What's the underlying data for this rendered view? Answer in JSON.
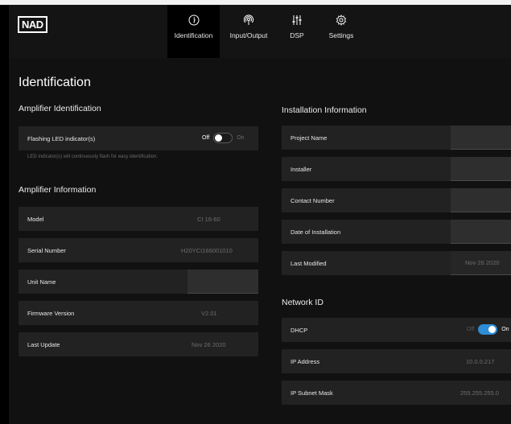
{
  "header": {
    "logo": "NAD",
    "tabs": [
      {
        "label": "Identification",
        "icon": "info-icon",
        "active": true
      },
      {
        "label": "Input/Output",
        "icon": "broadcast-icon",
        "active": false
      },
      {
        "label": "DSP",
        "icon": "sliders-icon",
        "active": false
      },
      {
        "label": "Settings",
        "icon": "gear-icon",
        "active": false
      }
    ]
  },
  "page": {
    "title": "Identification"
  },
  "amp_id": {
    "title": "Amplifier Identification",
    "flash_label": "Flashing LED indicator(s)",
    "off_label": "Off",
    "on_label": "On",
    "note": "LED indicator(s) will continuously flash for easy identification."
  },
  "amp_info": {
    "title": "Amplifier Information",
    "rows": [
      {
        "label": "Model",
        "value": "CI 16-60"
      },
      {
        "label": "Serial Number",
        "value": "H20YCI166001010"
      },
      {
        "label": "Unit Name",
        "value": ""
      },
      {
        "label": "Firmware Version",
        "value": "V2.01"
      },
      {
        "label": "Last Update",
        "value": "Nov 26 2020"
      }
    ]
  },
  "install": {
    "title": "Installation Information",
    "rows": [
      {
        "label": "Project Name",
        "value": ""
      },
      {
        "label": "Installer",
        "value": ""
      },
      {
        "label": "Contact Number",
        "value": ""
      },
      {
        "label": "Date of Installation",
        "value": ""
      },
      {
        "label": "Last Modified",
        "value": "Nov 26 2020"
      }
    ]
  },
  "network": {
    "title": "Network ID",
    "dhcp_label": "DHCP",
    "off_label": "Off",
    "on_label": "On",
    "ip_label": "IP Address",
    "ip_value": "10.0.0.217",
    "mask_label": "IP Subnet Mask",
    "mask_value": "255.255.255.0"
  },
  "colors": {
    "accent": "#2f8dd6",
    "row_bg": "#222222",
    "panel_bg": "#111111"
  }
}
